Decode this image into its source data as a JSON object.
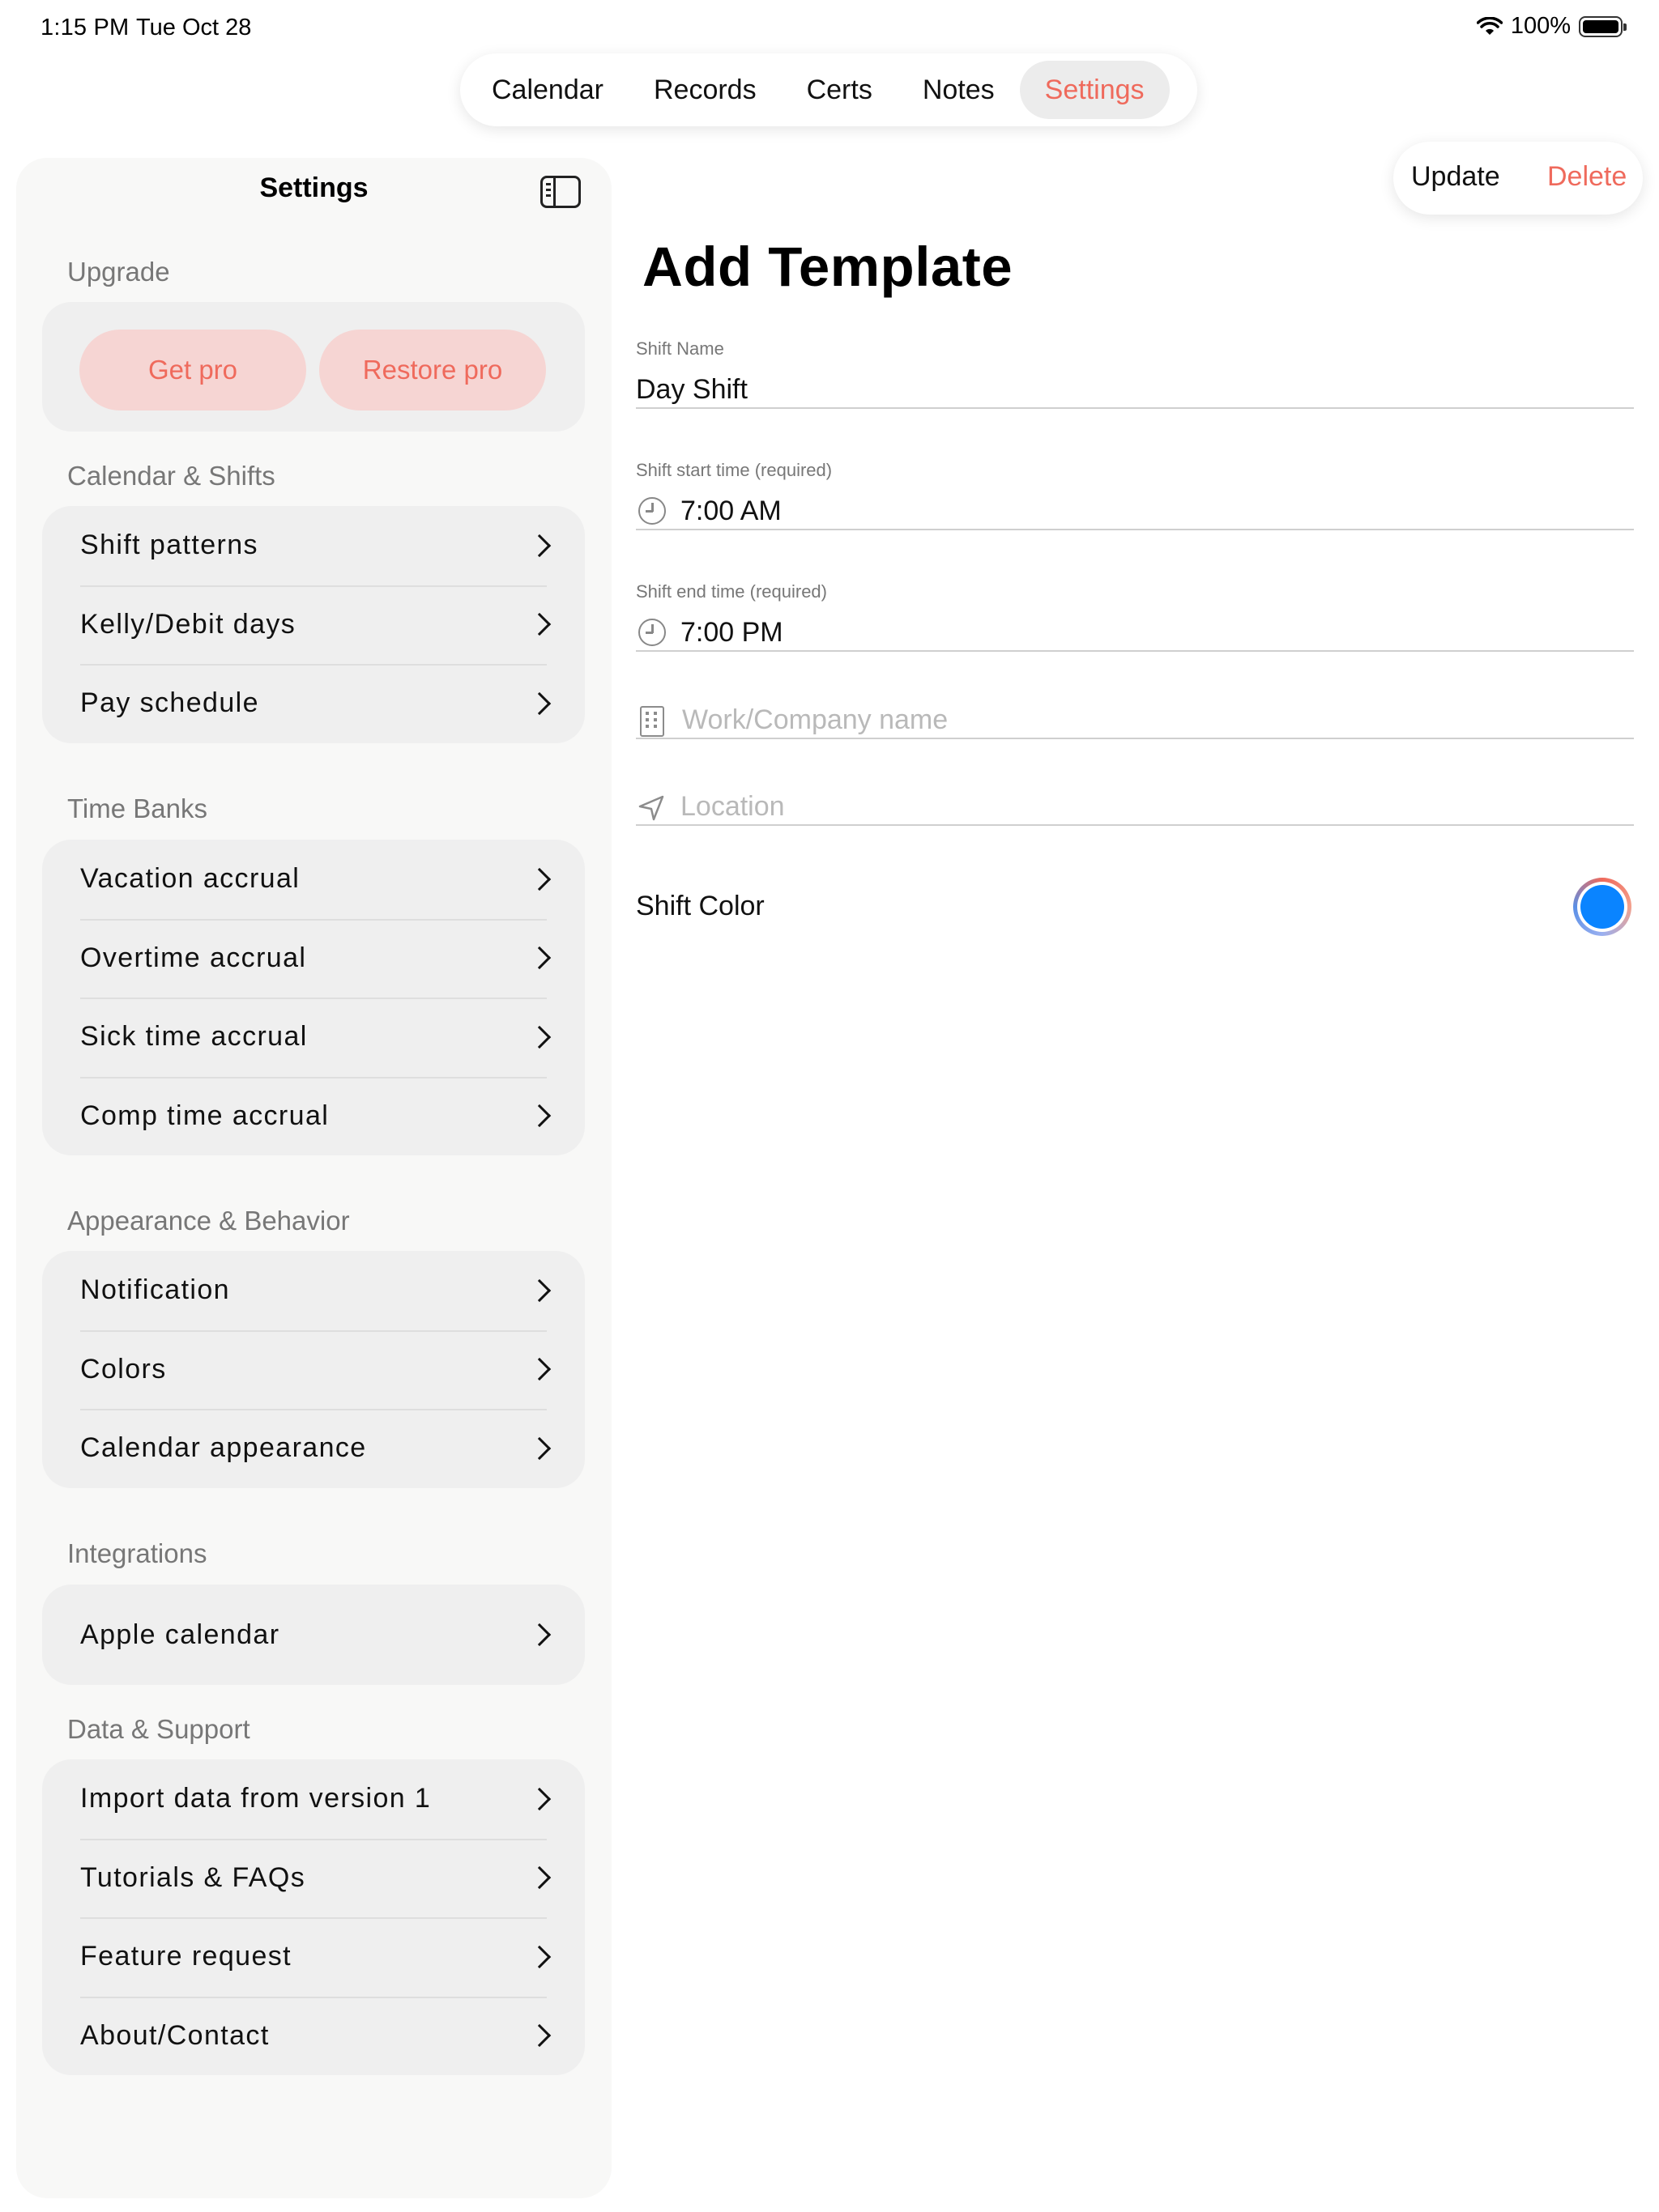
{
  "status_bar": {
    "time": "1:15 PM",
    "date": "Tue Oct 28",
    "battery": "100%"
  },
  "tabs": [
    {
      "label": "Calendar"
    },
    {
      "label": "Records"
    },
    {
      "label": "Certs"
    },
    {
      "label": "Notes"
    },
    {
      "label": "Settings",
      "active": true
    }
  ],
  "sidebar": {
    "title": "Settings",
    "upgrade": {
      "label": "Upgrade",
      "get_pro": "Get pro",
      "restore_pro": "Restore pro"
    },
    "sections": [
      {
        "label": "Calendar & Shifts",
        "items": [
          "Shift patterns",
          "Kelly/Debit days",
          "Pay schedule"
        ]
      },
      {
        "label": "Time Banks",
        "items": [
          "Vacation accrual",
          "Overtime accrual",
          "Sick time accrual",
          "Comp time accrual"
        ]
      },
      {
        "label": "Appearance & Behavior",
        "items": [
          "Notification",
          "Colors",
          "Calendar appearance"
        ]
      },
      {
        "label": "Integrations",
        "items": [
          "Apple calendar"
        ]
      },
      {
        "label": "Data & Support",
        "items": [
          "Import data from version 1",
          "Tutorials & FAQs",
          "Feature request",
          "About/Contact"
        ]
      }
    ]
  },
  "detail": {
    "actions": {
      "update": "Update",
      "delete": "Delete"
    },
    "title": "Add Template",
    "shift_name": {
      "label": "Shift Name",
      "value": "Day Shift"
    },
    "start_time": {
      "label": "Shift start time (required)",
      "value": "7:00 AM"
    },
    "end_time": {
      "label": "Shift end time (required)",
      "value": "7:00 PM"
    },
    "company": {
      "placeholder": "Work/Company name"
    },
    "location": {
      "placeholder": "Location"
    },
    "shift_color": {
      "label": "Shift Color",
      "color": "#0a84ff"
    }
  },
  "colors": {
    "accent": "#ef6a5c",
    "pro_button_bg": "#f6d5d3",
    "group_bg": "#efefef"
  }
}
